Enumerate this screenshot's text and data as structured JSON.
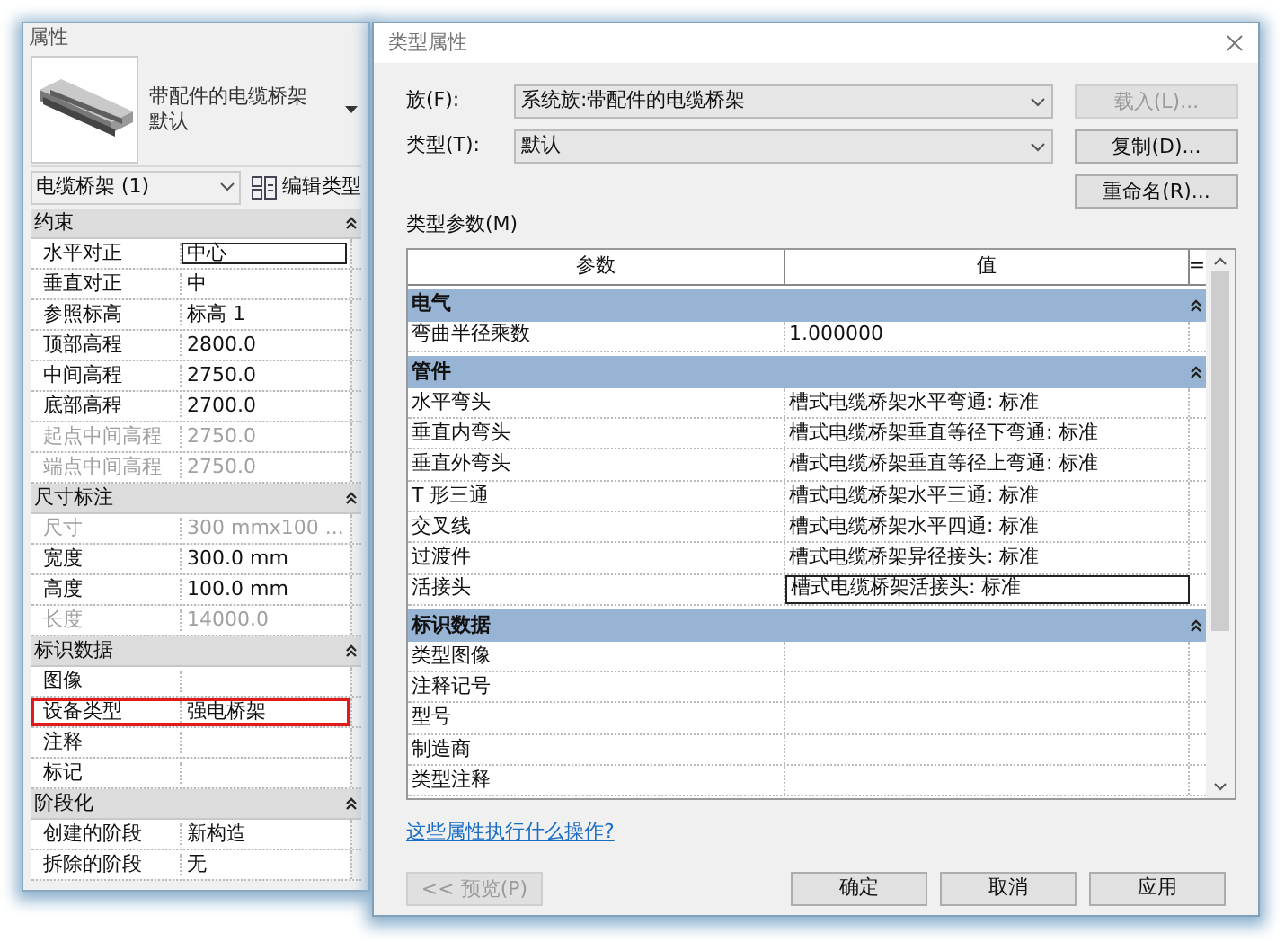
{
  "properties_panel": {
    "title": "属性",
    "element": {
      "name": "带配件的电缆桥架",
      "type": "默认"
    },
    "selector": "电缆桥架 (1)",
    "edit_type_button": "编辑类型",
    "groups": [
      {
        "name": "约束",
        "rows": [
          {
            "label": "水平对正",
            "value": "中心",
            "disabled": false,
            "editing": true,
            "highlighted": false
          },
          {
            "label": "垂直对正",
            "value": "中",
            "disabled": false,
            "editing": false,
            "highlighted": false
          },
          {
            "label": "参照标高",
            "value": "标高 1",
            "disabled": false,
            "editing": false,
            "highlighted": false
          },
          {
            "label": "顶部高程",
            "value": "2800.0",
            "disabled": false,
            "editing": false,
            "highlighted": false
          },
          {
            "label": "中间高程",
            "value": "2750.0",
            "disabled": false,
            "editing": false,
            "highlighted": false
          },
          {
            "label": "底部高程",
            "value": "2700.0",
            "disabled": false,
            "editing": false,
            "highlighted": false
          },
          {
            "label": "起点中间高程",
            "value": "2750.0",
            "disabled": true,
            "editing": false,
            "highlighted": false
          },
          {
            "label": "端点中间高程",
            "value": "2750.0",
            "disabled": true,
            "editing": false,
            "highlighted": false
          }
        ]
      },
      {
        "name": "尺寸标注",
        "rows": [
          {
            "label": "尺寸",
            "value": "300 mmx100 ...",
            "disabled": true,
            "editing": false,
            "highlighted": false
          },
          {
            "label": "宽度",
            "value": "300.0 mm",
            "disabled": false,
            "editing": false,
            "highlighted": false
          },
          {
            "label": "高度",
            "value": "100.0 mm",
            "disabled": false,
            "editing": false,
            "highlighted": false
          },
          {
            "label": "长度",
            "value": "14000.0",
            "disabled": true,
            "editing": false,
            "highlighted": false
          }
        ]
      },
      {
        "name": "标识数据",
        "rows": [
          {
            "label": "图像",
            "disabled": false,
            "editing": false,
            "highlighted": false
          },
          {
            "label": "设备类型",
            "value": "强电桥架",
            "disabled": false,
            "editing": false,
            "highlighted": true
          },
          {
            "label": "注释",
            "disabled": false,
            "editing": false,
            "highlighted": false
          },
          {
            "label": "标记",
            "disabled": false,
            "editing": false,
            "highlighted": false
          }
        ]
      },
      {
        "name": "阶段化",
        "rows": [
          {
            "label": "创建的阶段",
            "value": "新构造",
            "disabled": false,
            "editing": false,
            "highlighted": false
          },
          {
            "label": "拆除的阶段",
            "value": "无",
            "disabled": false,
            "editing": false,
            "highlighted": false
          }
        ]
      }
    ]
  },
  "dialog": {
    "title": "类型属性",
    "family": {
      "label": "族(F):",
      "value": "系统族:带配件的电缆桥架"
    },
    "type": {
      "label": "类型(T):",
      "value": "默认"
    },
    "side_buttons": [
      {
        "label": "载入(L)...",
        "disabled": true
      },
      {
        "label": "复制(D)...",
        "disabled": false
      },
      {
        "label": "重命名(R)...",
        "disabled": false
      }
    ],
    "params_label": "类型参数(M)",
    "table": {
      "columns": [
        "参数",
        "值",
        "="
      ],
      "groups": [
        {
          "name": "电气",
          "rows": [
            {
              "parameter": "弯曲半径乘数",
              "value": "1.000000",
              "editing": false
            }
          ]
        },
        {
          "name": "管件",
          "rows": [
            {
              "parameter": "水平弯头",
              "value": "槽式电缆桥架水平弯通: 标准",
              "editing": false
            },
            {
              "parameter": "垂直内弯头",
              "value": "槽式电缆桥架垂直等径下弯通: 标准",
              "editing": false
            },
            {
              "parameter": "垂直外弯头",
              "value": "槽式电缆桥架垂直等径上弯通: 标准",
              "editing": false
            },
            {
              "parameter": "T 形三通",
              "value": "槽式电缆桥架水平三通: 标准",
              "editing": false
            },
            {
              "parameter": "交叉线",
              "value": "槽式电缆桥架水平四通: 标准",
              "editing": false
            },
            {
              "parameter": "过渡件",
              "value": "槽式电缆桥架异径接头: 标准",
              "editing": false
            },
            {
              "parameter": "活接头",
              "value": "槽式电缆桥架活接头: 标准",
              "editing": true
            }
          ]
        },
        {
          "name": "标识数据",
          "rows": [
            {
              "parameter": "类型图像",
              "editing": false
            },
            {
              "parameter": "注释记号",
              "editing": false
            },
            {
              "parameter": "型号",
              "editing": false
            },
            {
              "parameter": "制造商",
              "editing": false
            },
            {
              "parameter": "类型注释",
              "editing": false
            }
          ]
        }
      ]
    },
    "help_link": "这些属性执行什么操作?",
    "preview_button": {
      "label": "<< 预览(P)",
      "disabled": true
    },
    "footer_buttons": [
      "确定",
      "取消",
      "应用"
    ]
  }
}
